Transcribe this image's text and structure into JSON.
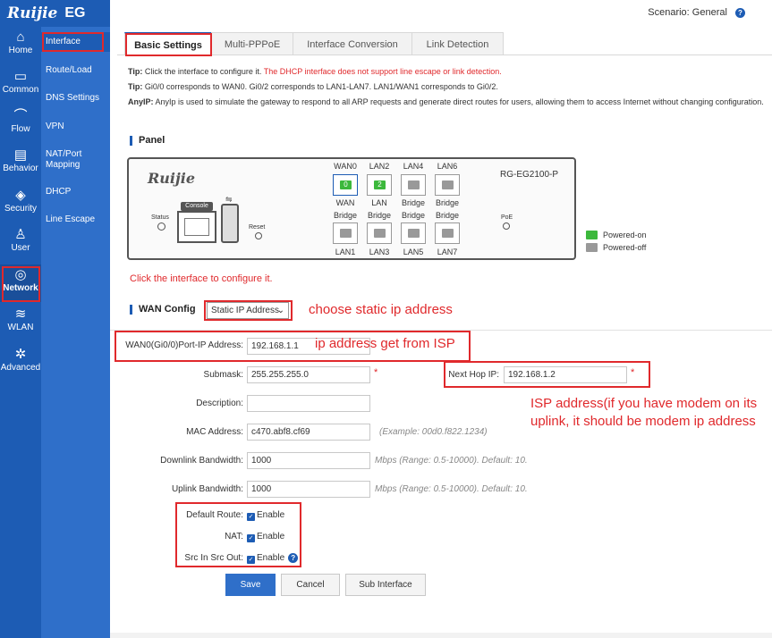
{
  "app": {
    "brand": "Ruijie",
    "product": "EG"
  },
  "header": {
    "scenario_label": "Scenario:",
    "scenario_value": "General",
    "help": "?"
  },
  "nav": [
    {
      "label": "Home",
      "icon": "⌂"
    },
    {
      "label": "Common",
      "icon": "▭"
    },
    {
      "label": "Flow",
      "icon": "⌒"
    },
    {
      "label": "Behavior",
      "icon": "▤"
    },
    {
      "label": "Security",
      "icon": "◈"
    },
    {
      "label": "User",
      "icon": "♙"
    },
    {
      "label": "Network",
      "icon": "◎"
    },
    {
      "label": "WLAN",
      "icon": "≋"
    },
    {
      "label": "Advanced",
      "icon": "✲"
    }
  ],
  "subnav": [
    "Interface",
    "Route/Load",
    "DNS Settings",
    "VPN",
    "NAT/Port Mapping",
    "DHCP",
    "Line Escape"
  ],
  "tabs": [
    "Basic Settings",
    "Multi-PPPoE",
    "Interface Conversion",
    "Link Detection"
  ],
  "tips": {
    "tip1_label": "Tip:",
    "tip1_text": "Click the interface to configure it.",
    "tip1_warn": "The DHCP interface does not support line escape or link detection.",
    "tip2_label": "Tip:",
    "tip2_text": "Gi0/0 corresponds to WAN0. Gi0/2 corresponds to LAN1-LAN7. LAN1/WAN1 corresponds to Gi0/2.",
    "tip3_label": "AnyIP:",
    "tip3_text": "AnyIp is used to simulate the gateway to respond to all ARP requests and generate direct routes for users, allowing them to access Internet without changing configuration."
  },
  "panel": {
    "title": "Panel",
    "logo": "Ruijie",
    "console": "Console",
    "status": "Status",
    "reset": "Reset",
    "poe": "PoE",
    "model": "RG-EG2100-P",
    "top_labels": [
      "WAN0",
      "LAN2",
      "LAN4",
      "LAN6"
    ],
    "mid_labels_a": [
      "WAN",
      "LAN",
      "Bridge",
      "Bridge"
    ],
    "mid_labels_b": [
      "Bridge",
      "Bridge",
      "Bridge",
      "Bridge"
    ],
    "bottom_labels": [
      "LAN1",
      "LAN3",
      "LAN5",
      "LAN7"
    ],
    "top_ports": [
      "0",
      "2",
      "",
      ""
    ],
    "legend_on": "Powered-on",
    "legend_off": "Powered-off",
    "hint": "Click the interface to configure it."
  },
  "wan": {
    "title": "WAN Config",
    "mode": "Static IP Address",
    "annot_mode": "choose static ip address",
    "ip_label": "WAN0(Gi0/0)Port-IP Address:",
    "ip_value": "192.168.1.1",
    "annot_ip": "ip address get from ISP",
    "submask_label": "Submask:",
    "submask_value": "255.255.255.0",
    "nexthop_label": "Next Hop IP:",
    "nexthop_value": "192.168.1.2",
    "annot_isp1": "ISP address(if you have modem on its",
    "annot_isp2": "uplink, it should be modem ip address",
    "desc_label": "Description:",
    "desc_value": "",
    "mac_label": "MAC Address:",
    "mac_value": "c470.abf8.cf69",
    "mac_hint": "(Example: 00d0.f822.1234)",
    "down_label": "Downlink Bandwidth:",
    "down_value": "1000",
    "down_hint": "Mbps (Range: 0.5-10000). Default: 10.",
    "up_label": "Uplink Bandwidth:",
    "up_value": "1000",
    "up_hint": "Mbps (Range: 0.5-10000). Default: 10.",
    "route_label": "Default Route:",
    "nat_label": "NAT:",
    "src_label": "Src In Src Out:",
    "enable": "Enable",
    "req": "*"
  },
  "buttons": {
    "save": "Save",
    "cancel": "Cancel",
    "sub": "Sub Interface"
  },
  "colors": {
    "sidebar": "#1d5cb4",
    "accent": "#2f6fc9",
    "annotation": "#e0292c",
    "port_on": "#3cb83c",
    "port_off": "#999999"
  }
}
